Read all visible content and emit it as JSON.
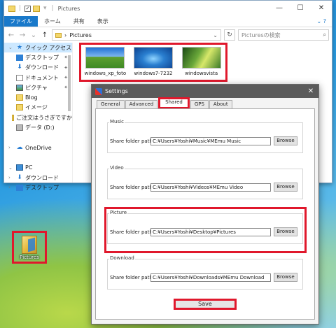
{
  "explorer": {
    "title": "Pictures",
    "ribbon_tabs": [
      "ファイル",
      "ホーム",
      "共有",
      "表示"
    ],
    "address_path": "Pictures",
    "search_placeholder": "Picturesの検索",
    "nav_items": [
      {
        "label": "クイック アクセス",
        "icon": "star-icon",
        "arrow": "v",
        "pinned": false,
        "selected": true
      },
      {
        "label": "デスクトップ",
        "icon": "desktop-icon",
        "arrow": "",
        "pinned": true
      },
      {
        "label": "ダウンロード",
        "icon": "download-icon",
        "arrow": "",
        "pinned": true
      },
      {
        "label": "ドキュメント",
        "icon": "document-icon",
        "arrow": "",
        "pinned": true
      },
      {
        "label": "ピクチャ",
        "icon": "pictures-icon",
        "arrow": "",
        "pinned": true
      },
      {
        "label": "Blog",
        "icon": "folder-icon",
        "arrow": "",
        "pinned": false
      },
      {
        "label": "イメージ",
        "icon": "folder-icon",
        "arrow": "",
        "pinned": false
      },
      {
        "label": "ご注文はうさぎですか",
        "icon": "folder-icon",
        "arrow": "",
        "pinned": false
      },
      {
        "label": "データ (D:)",
        "icon": "drive-icon",
        "arrow": "",
        "pinned": false
      },
      {
        "label": "",
        "icon": "",
        "arrow": "",
        "pinned": false
      },
      {
        "label": "OneDrive",
        "icon": "cloud-icon",
        "arrow": ">",
        "pinned": false
      },
      {
        "label": "",
        "icon": "",
        "arrow": "",
        "pinned": false
      },
      {
        "label": "PC",
        "icon": "pc-icon",
        "arrow": "v",
        "pinned": false
      },
      {
        "label": "ダウンロード",
        "icon": "download-icon",
        "arrow": ">",
        "pinned": false
      },
      {
        "label": "デスクトップ",
        "icon": "desktop-icon",
        "arrow": ">",
        "pinned": false
      }
    ],
    "files": [
      {
        "name": "windows_xp_foto",
        "thumb": "xp"
      },
      {
        "name": "windows7-7232",
        "thumb": "w7"
      },
      {
        "name": "windowsvista",
        "thumb": "vista"
      }
    ]
  },
  "desktop_icon": {
    "label": "Pictures"
  },
  "dialog": {
    "title": "Settings",
    "tabs": [
      "General",
      "Advanced",
      "Shared",
      "GPS",
      "About"
    ],
    "active_tab": "Shared",
    "groups": [
      {
        "title": "Music",
        "label": "Share folder path",
        "path": "C:¥Users¥Yoshi¥Music¥MEmu Music",
        "button": "Browse"
      },
      {
        "title": "Video",
        "label": "Share folder path",
        "path": "C:¥Users¥Yoshi¥Videos¥MEmu Video",
        "button": "Browse"
      },
      {
        "title": "Picture",
        "label": "Share folder path",
        "path": "C:¥Users¥Yoshi¥Desktop¥Pictures",
        "button": "Browse"
      },
      {
        "title": "Download",
        "label": "Share folder path",
        "path": "C:¥Users¥Yoshi¥Downloads¥MEmu Download",
        "button": "Browse"
      }
    ],
    "save_label": "Save"
  },
  "colors": {
    "highlight": "#e0182c",
    "ribbon_file": "#1979ca",
    "dialog_title": "#5b5b5b"
  }
}
